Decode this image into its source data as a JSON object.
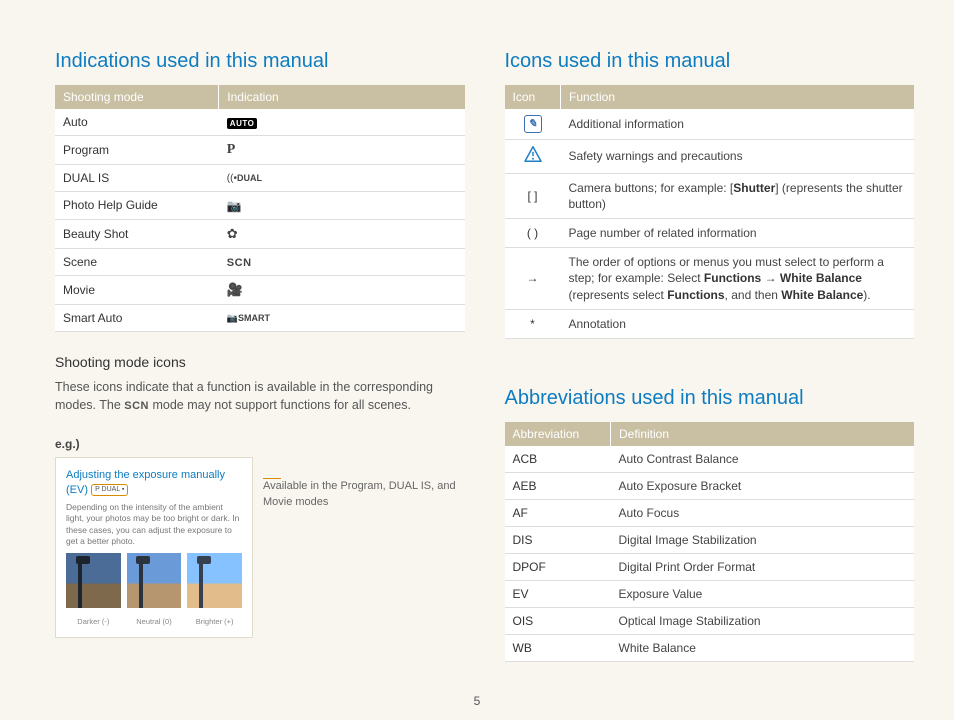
{
  "pageNumber": "5",
  "left": {
    "heading": "Indications used in this manual",
    "table": {
      "h1": "Shooting mode",
      "h2": "Indication",
      "rows": [
        {
          "mode": "Auto",
          "ind": "AUTO",
          "icon": "auto"
        },
        {
          "mode": "Program",
          "ind": "P",
          "icon": "p"
        },
        {
          "mode": "DUAL IS",
          "ind": "DUAL",
          "icon": "dual"
        },
        {
          "mode": "Photo Help Guide",
          "ind": "",
          "icon": "help"
        },
        {
          "mode": "Beauty Shot",
          "ind": "",
          "icon": "beauty"
        },
        {
          "mode": "Scene",
          "ind": "SCN",
          "icon": "scn"
        },
        {
          "mode": "Movie",
          "ind": "",
          "icon": "movie"
        },
        {
          "mode": "Smart Auto",
          "ind": "SMART",
          "icon": "smart"
        }
      ]
    },
    "sub": "Shooting mode icons",
    "para1a": "These icons indicate that a function is available in the corresponding modes. The ",
    "para1b": " mode may not support functions for all scenes.",
    "scn_inline": "SCN",
    "eg": "e.g.)",
    "example": {
      "titleA": "Adjusting the exposure manually",
      "titleB": "(EV)",
      "pill": "P  DUAL  ▪",
      "desc": "Depending on the intensity of the ambient light, your photos may be too bright or dark. In these cases, you can adjust the exposure to get a better photo.",
      "t1": "Darker (-)",
      "t2": "Neutral (0)",
      "t3": "Brighter (+)"
    },
    "caption": "Available in the Program, DUAL IS, and Movie modes"
  },
  "rightA": {
    "heading": "Icons used in this manual",
    "h1": "Icon",
    "h2": "Function",
    "rows": [
      {
        "i": "note",
        "t": "Additional information"
      },
      {
        "i": "warn",
        "t": "Safety warnings and precautions"
      },
      {
        "i": "[  ]",
        "html": "Camera buttons; for example: [<b>Shutter</b>] (represents the shutter button)"
      },
      {
        "i": "(  )",
        "t": "Page number of related information"
      },
      {
        "i": "→",
        "html": "The order of options or menus you must select to perform a step; for example: Select <b>Functions</b> → <b>White Balance</b> (represents select <b>Functions</b>, and then <b>White Balance</b>)."
      },
      {
        "i": "*",
        "t": "Annotation"
      }
    ]
  },
  "rightB": {
    "heading": "Abbreviations used in this manual",
    "h1": "Abbreviation",
    "h2": "Definition",
    "rows": [
      {
        "a": "ACB",
        "d": "Auto Contrast Balance"
      },
      {
        "a": "AEB",
        "d": "Auto Exposure Bracket"
      },
      {
        "a": "AF",
        "d": "Auto Focus"
      },
      {
        "a": "DIS",
        "d": "Digital Image Stabilization"
      },
      {
        "a": "DPOF",
        "d": "Digital Print Order Format"
      },
      {
        "a": "EV",
        "d": "Exposure Value"
      },
      {
        "a": "OIS",
        "d": "Optical Image Stabilization"
      },
      {
        "a": "WB",
        "d": "White Balance"
      }
    ]
  }
}
